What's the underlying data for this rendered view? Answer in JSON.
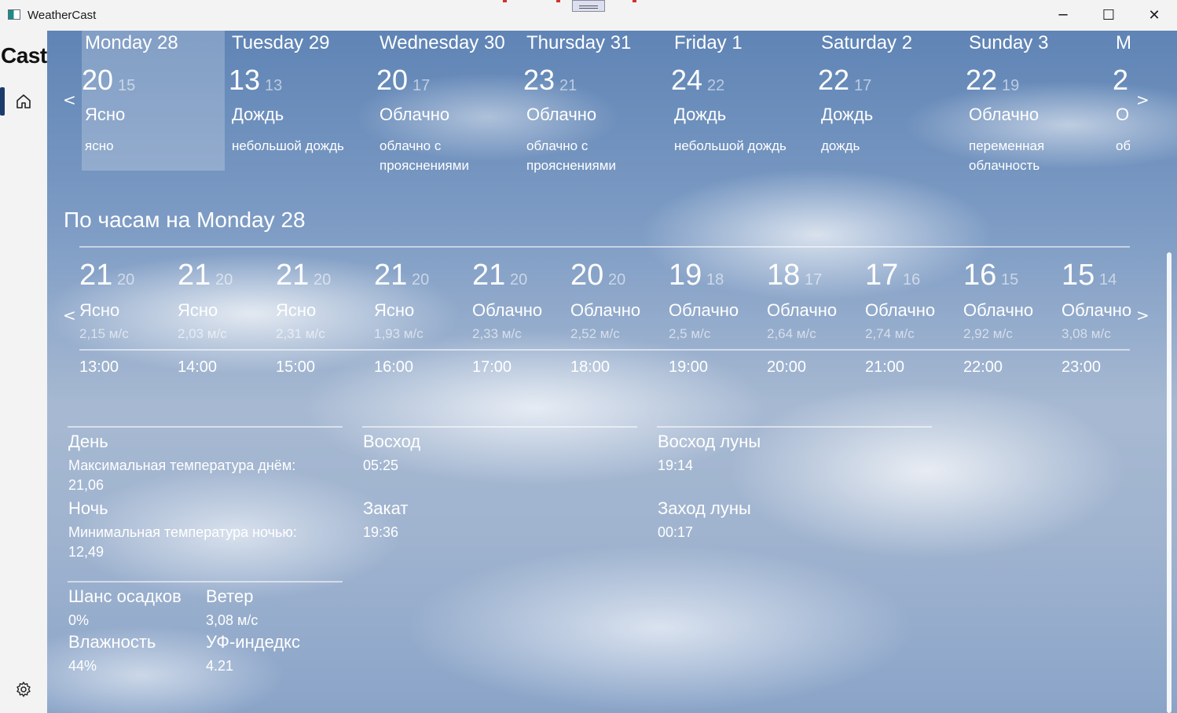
{
  "window": {
    "title": "WeatherCast",
    "minimize": "─",
    "maximize": "☐",
    "close": "✕"
  },
  "sidebar": {
    "title": "Cast"
  },
  "daily": {
    "prev": "<",
    "next": ">",
    "days": [
      {
        "name": "Monday 28",
        "max": "20",
        "min": "15",
        "condition": "Ясно",
        "description": "ясно"
      },
      {
        "name": "Tuesday 29",
        "max": "13",
        "min": "13",
        "condition": "Дождь",
        "description": "небольшой дождь"
      },
      {
        "name": "Wednesday 30",
        "max": "20",
        "min": "17",
        "condition": "Облачно",
        "description": "облачно с прояснениями"
      },
      {
        "name": "Thursday 31",
        "max": "23",
        "min": "21",
        "condition": "Облачно",
        "description": "облачно с прояснениями"
      },
      {
        "name": "Friday 1",
        "max": "24",
        "min": "22",
        "condition": "Дождь",
        "description": "небольшой дождь"
      },
      {
        "name": "Saturday 2",
        "max": "22",
        "min": "17",
        "condition": "Дождь",
        "description": "дождь"
      },
      {
        "name": "Sunday 3",
        "max": "22",
        "min": "19",
        "condition": "Облачно",
        "description": "переменная облачность"
      },
      {
        "name": "M",
        "max": "2",
        "min": "",
        "condition": "О",
        "description": "об пр"
      }
    ]
  },
  "hourly": {
    "title_prefix": "По часам на",
    "title_day": "Monday 28",
    "prev": "<",
    "next": ">",
    "hours": [
      {
        "max": "21",
        "min": "20",
        "condition": "Ясно",
        "wind": "2,15 м/с",
        "time": "13:00"
      },
      {
        "max": "21",
        "min": "20",
        "condition": "Ясно",
        "wind": "2,03 м/с",
        "time": "14:00"
      },
      {
        "max": "21",
        "min": "20",
        "condition": "Ясно",
        "wind": "2,31 м/с",
        "time": "15:00"
      },
      {
        "max": "21",
        "min": "20",
        "condition": "Ясно",
        "wind": "1,93 м/с",
        "time": "16:00"
      },
      {
        "max": "21",
        "min": "20",
        "condition": "Облачно",
        "wind": "2,33 м/с",
        "time": "17:00"
      },
      {
        "max": "20",
        "min": "20",
        "condition": "Облачно",
        "wind": "2,52 м/с",
        "time": "18:00"
      },
      {
        "max": "19",
        "min": "18",
        "condition": "Облачно",
        "wind": "2,5 м/с",
        "time": "19:00"
      },
      {
        "max": "18",
        "min": "17",
        "condition": "Облачно",
        "wind": "2,64 м/с",
        "time": "20:00"
      },
      {
        "max": "17",
        "min": "16",
        "condition": "Облачно",
        "wind": "2,74 м/с",
        "time": "21:00"
      },
      {
        "max": "16",
        "min": "15",
        "condition": "Облачно",
        "wind": "2,92 м/с",
        "time": "22:00"
      },
      {
        "max": "15",
        "min": "14",
        "condition": "Облачно",
        "wind": "3,08 м/с",
        "time": "23:00"
      }
    ]
  },
  "details": {
    "day_label": "День",
    "day_max_label": "Максимальная температура днём:",
    "day_max_value": "21,06",
    "night_label": "Ночь",
    "night_min_label": "Минимальная температура ночью:",
    "night_min_value": "12,49",
    "sunrise_label": "Восход",
    "sunrise_value": "05:25",
    "sunset_label": "Закат",
    "sunset_value": "19:36",
    "moonrise_label": "Восход луны",
    "moonrise_value": "19:14",
    "moonset_label": "Заход луны",
    "moonset_value": "00:17",
    "precip_label": "Шанс осадков",
    "precip_value": "0%",
    "wind_label": "Ветер",
    "wind_value": "3,08 м/с",
    "humidity_label": "Влажность",
    "humidity_value": "44%",
    "uv_label": "УФ-индедкс",
    "uv_value": "4.21"
  }
}
